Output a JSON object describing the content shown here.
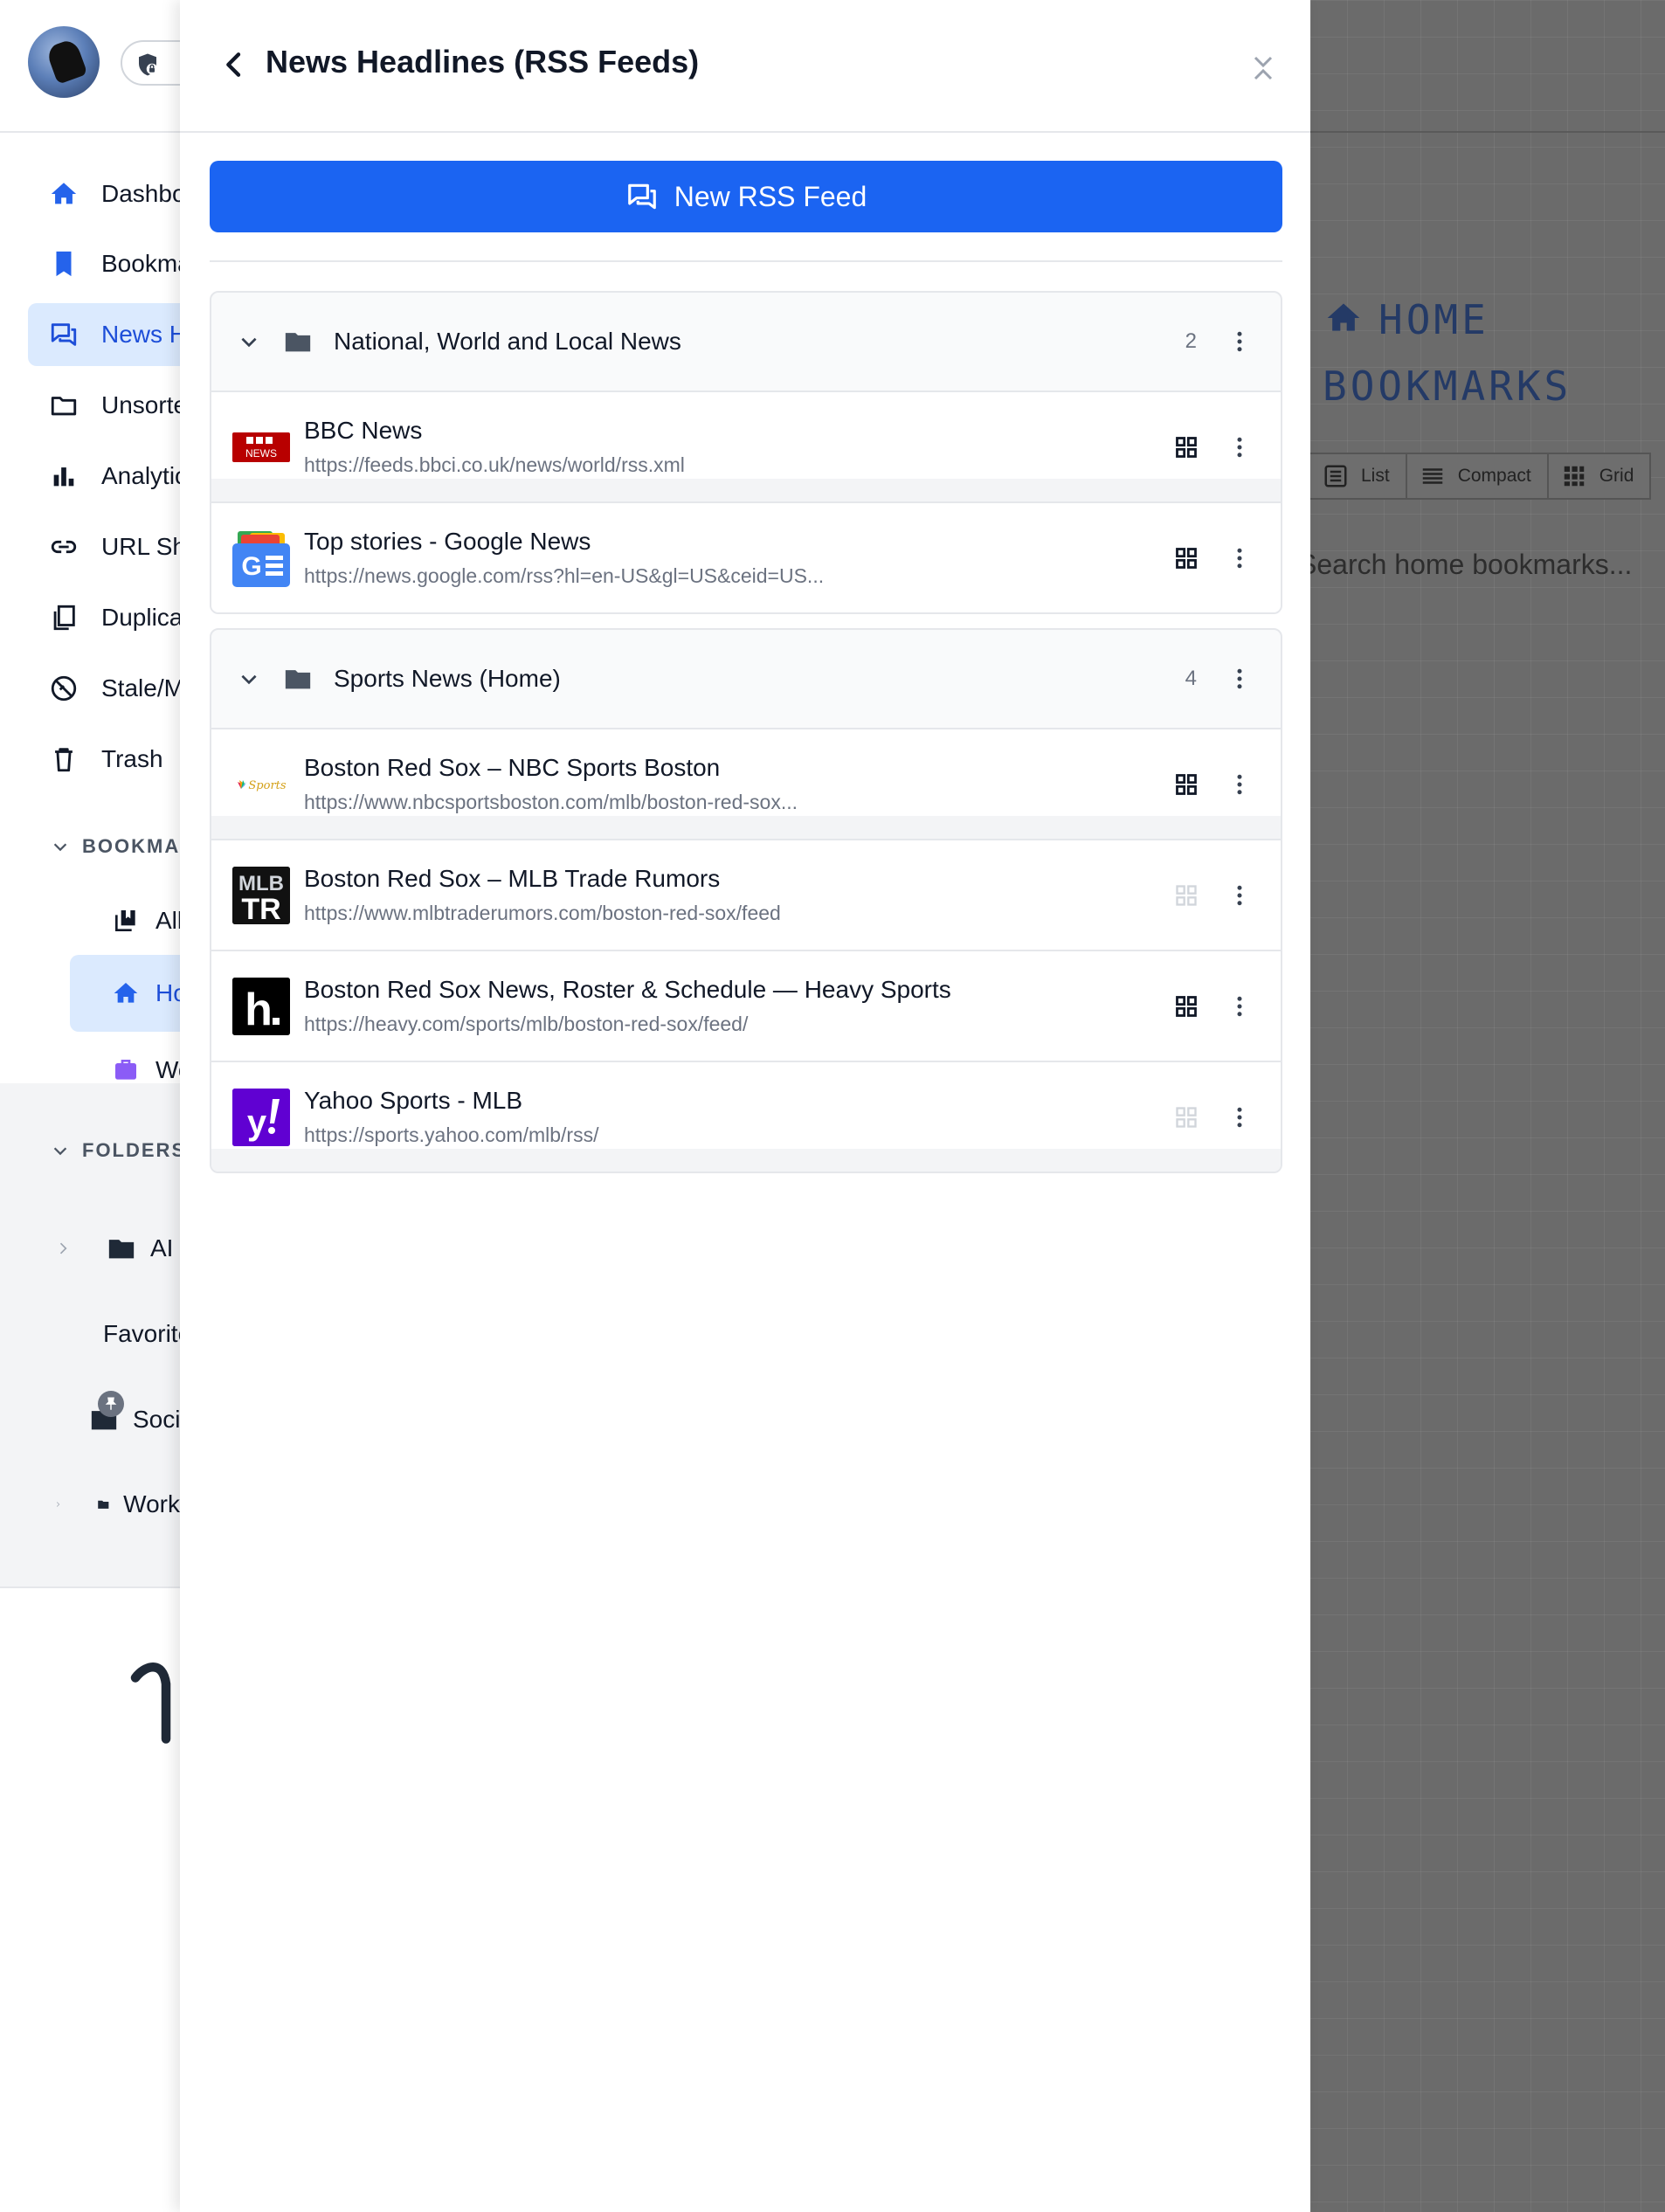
{
  "drawer": {
    "title": "News Headlines (RSS Feeds)",
    "new_feed_label": "New RSS Feed",
    "groups": [
      {
        "name": "National, World and Local News",
        "count": "2",
        "feeds": [
          {
            "name": "BBC News",
            "url": "https://feeds.bbci.co.uk/news/world/rss.xml",
            "logo": "bbc-news-logo",
            "grid_enabled": true
          },
          {
            "name": "Top stories - Google News",
            "url": "https://news.google.com/rss?hl=en-US&gl=US&ceid=US...",
            "logo": "google-news-logo",
            "grid_enabled": true
          }
        ]
      },
      {
        "name": "Sports News (Home)",
        "count": "4",
        "feeds": [
          {
            "name": "Boston Red Sox – NBC Sports Boston",
            "url": "https://www.nbcsportsboston.com/mlb/boston-red-sox...",
            "logo": "nbc-sports-logo",
            "grid_enabled": true
          },
          {
            "name": "Boston Red Sox – MLB Trade Rumors",
            "url": "https://www.mlbtraderumors.com/boston-red-sox/feed",
            "logo": "mlbtr-logo",
            "grid_enabled": false
          },
          {
            "name": "Boston Red Sox News, Roster & Schedule — Heavy Sports",
            "url": "https://heavy.com/sports/mlb/boston-red-sox/feed/",
            "logo": "heavy-logo",
            "grid_enabled": true
          },
          {
            "name": "Yahoo Sports - MLB",
            "url": "https://sports.yahoo.com/mlb/rss/",
            "logo": "yahoo-sports-logo",
            "grid_enabled": false
          }
        ]
      }
    ]
  },
  "sidebar": {
    "nav": [
      {
        "label": "Dashboard",
        "icon": "home-icon"
      },
      {
        "label": "Bookmarks",
        "icon": "bookmark-icon"
      },
      {
        "label": "News Headlines",
        "icon": "rss-chat-icon",
        "active": true
      },
      {
        "label": "Unsorted",
        "icon": "folder-outline-icon"
      },
      {
        "label": "Analytics",
        "icon": "bar-chart-icon"
      },
      {
        "label": "URL Shortener",
        "icon": "link-icon"
      },
      {
        "label": "Duplicates",
        "icon": "duplicate-icon"
      },
      {
        "label": "Stale/Missing",
        "icon": "broken-link-icon"
      },
      {
        "label": "Trash",
        "icon": "trash-icon"
      }
    ],
    "bookmarks_heading": "BOOKMARKS",
    "bookmark_items": [
      {
        "label": "All",
        "icon": "library-icon"
      },
      {
        "label": "Home",
        "icon": "home-icon",
        "active": true
      },
      {
        "label": "Work",
        "icon": "briefcase-icon"
      }
    ],
    "folders_heading": "FOLDERS",
    "folders": [
      {
        "label": "AI",
        "pinned": false
      },
      {
        "label": "Favorites",
        "pinned": false
      },
      {
        "label": "Social",
        "pinned": true
      },
      {
        "label": "Work",
        "pinned": false
      }
    ]
  },
  "background": {
    "page_title": "HOME BOOKMARKS",
    "views": [
      "List",
      "Compact",
      "Grid"
    ],
    "search_placeholder": "Search home bookmarks..."
  },
  "colors": {
    "primary": "#1b64f2",
    "active_bg": "#dbeafe",
    "active_text": "#1d4ed8",
    "overlay": "#6b6b6b"
  }
}
